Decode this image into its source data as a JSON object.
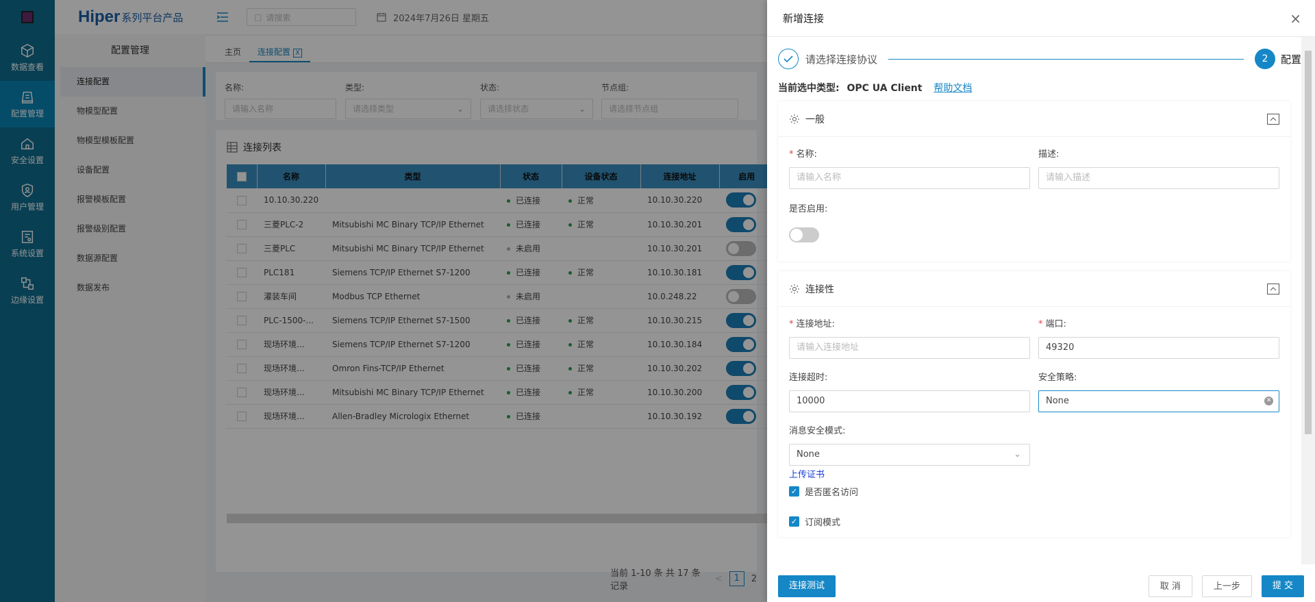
{
  "rail": [
    {
      "label": "数据查看",
      "icon": "cube-icon"
    },
    {
      "label": "配置管理",
      "icon": "config-icon"
    },
    {
      "label": "安全设置",
      "icon": "home-shield-icon"
    },
    {
      "label": "用户管理",
      "icon": "user-shield-icon"
    },
    {
      "label": "系统设置",
      "icon": "system-icon"
    },
    {
      "label": "边缘设置",
      "icon": "edge-icon"
    }
  ],
  "brand": {
    "name": "Hiper",
    "suffix": "系列平台产品"
  },
  "sub": {
    "title": "配置管理",
    "items": [
      "连接配置",
      "物模型配置",
      "物模型模板配置",
      "设备配置",
      "报警模板配置",
      "报警级别配置",
      "数据源配置",
      "数据发布"
    ]
  },
  "topbar": {
    "search_placeholder": "请搜索",
    "date": "2024年7月26日 星期五"
  },
  "tabs": [
    {
      "label": "主页"
    },
    {
      "label": "连接配置",
      "close": "X"
    }
  ],
  "filter": {
    "name_label": "名称:",
    "name_placeholder": "请输入名称",
    "type_label": "类型:",
    "type_placeholder": "请选择类型",
    "status_label": "状态:",
    "status_placeholder": "请选择状态",
    "group_label": "节点组:",
    "group_placeholder": "请选择节点组"
  },
  "list": {
    "title": "连接列表",
    "columns": [
      "名称",
      "类型",
      "状态",
      "设备状态",
      "连接地址",
      "启用"
    ],
    "rows": [
      {
        "name": "10.10.30.220",
        "type": "",
        "status": "已连接",
        "dev": "正常",
        "addr": "10.10.30.220",
        "on": true
      },
      {
        "name": "三菱PLC-2",
        "type": "Mitsubishi MC Binary TCP/IP Ethernet",
        "status": "已连接",
        "dev": "正常",
        "addr": "10.10.30.201",
        "on": true
      },
      {
        "name": "三菱PLC",
        "type": "Mitsubishi MC Binary TCP/IP Ethernet",
        "status": "未启用",
        "dev": "",
        "addr": "10.10.30.201",
        "on": false
      },
      {
        "name": "PLC181",
        "type": "Siemens TCP/IP Ethernet S7-1200",
        "status": "已连接",
        "dev": "正常",
        "addr": "10.10.30.181",
        "on": true
      },
      {
        "name": "灌装车间",
        "type": "Modbus TCP Ethernet",
        "status": "未启用",
        "dev": "",
        "addr": "10.0.248.22",
        "on": false
      },
      {
        "name": "PLC-1500-...",
        "type": "Siemens TCP/IP Ethernet S7-1500",
        "status": "已连接",
        "dev": "正常",
        "addr": "10.10.30.215",
        "on": true
      },
      {
        "name": "现场环境...",
        "type": "Siemens TCP/IP Ethernet S7-1200",
        "status": "已连接",
        "dev": "正常",
        "addr": "10.10.30.184",
        "on": true
      },
      {
        "name": "现场环境...",
        "type": "Omron Fins-TCP/IP Ethernet",
        "status": "已连接",
        "dev": "正常",
        "addr": "10.10.30.202",
        "on": true
      },
      {
        "name": "现场环境...",
        "type": "Mitsubishi MC Binary TCP/IP Ethernet",
        "status": "已连接",
        "dev": "正常",
        "addr": "10.10.30.200",
        "on": true
      },
      {
        "name": "现场环境...",
        "type": "Allen-Bradley Micrologix Ethernet",
        "status": "已连接",
        "dev": "",
        "addr": "10.10.30.192",
        "on": true
      }
    ],
    "pager_text": "当前 1-10 条 共 17 条 记录",
    "prev": "<",
    "pages": [
      "1",
      "2"
    ]
  },
  "drawer": {
    "title": "新增连接",
    "close": "×",
    "step1": "请选择连接协议",
    "step2_num": "2",
    "step2": "配置",
    "cur_type_label": "当前选中类型:",
    "cur_type_value": "OPC UA Client",
    "help": "帮助文档",
    "general": {
      "title": "一般",
      "name_label": "名称:",
      "name_placeholder": "请输入名称",
      "desc_label": "描述:",
      "desc_placeholder": "请输入描述",
      "enable_label": "是否启用:"
    },
    "conn": {
      "title": "连接性",
      "addr_label": "连接地址:",
      "addr_placeholder": "请输入连接地址",
      "port_label": "端口:",
      "port_value": "49320",
      "timeout_label": "连接超时:",
      "timeout_value": "10000",
      "policy_label": "安全策略:",
      "policy_value": "None",
      "msgmode_label": "消息安全模式:",
      "msgmode_value": "None",
      "upload": "上传证书",
      "anon": "是否匿名访问",
      "subscribe": "订阅模式"
    },
    "buttons": {
      "test": "连接测试",
      "cancel": "取 消",
      "prev": "上一步",
      "submit": "提 交"
    }
  },
  "colors": {
    "rail": "#0f6d8f",
    "accent": "#1587c7",
    "ok": "#2e9e4e",
    "off": "#b0b0b0"
  }
}
